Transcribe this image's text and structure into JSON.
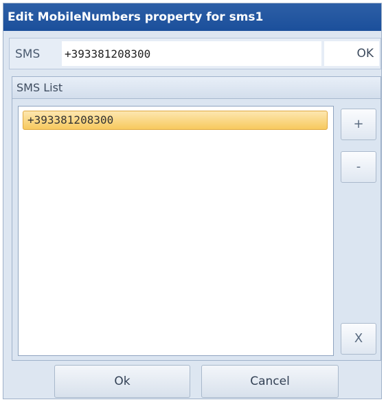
{
  "window": {
    "title": "Edit MobileNumbers property for sms1"
  },
  "sms": {
    "label": "SMS",
    "value": "+393381208300",
    "ok_label": "OK"
  },
  "sms_list": {
    "header": "SMS List",
    "items": [
      "+393381208300"
    ],
    "add_label": "+",
    "remove_label": "-",
    "clear_label": "X"
  },
  "buttons": {
    "ok_label": "Ok",
    "cancel_label": "Cancel"
  },
  "colors": {
    "title_bg": "#1b4f9b",
    "selected_item": "#f7c95e",
    "panel_bg": "#dde6f1"
  }
}
